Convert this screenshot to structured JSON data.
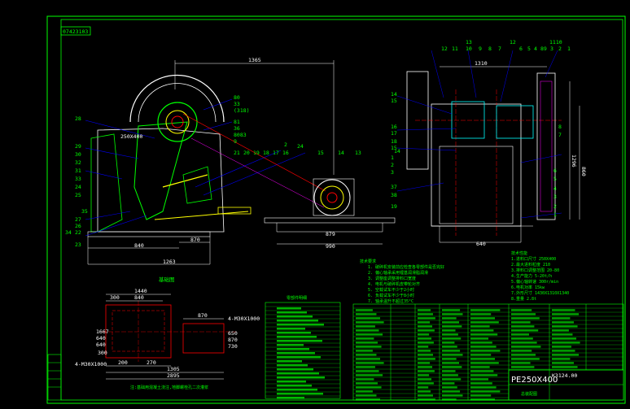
{
  "sheet": {
    "drawing_number": "07423103",
    "model": "PE250X400",
    "scale_code": "K3124.00",
    "total_length_dim": "1365"
  },
  "side_view": {
    "opening_label": "250X400",
    "dims": {
      "width_1": "840",
      "width_2": "870",
      "width_3": "1263"
    },
    "part_numbers_left": [
      "28",
      "29",
      "30",
      "32",
      "31",
      "33",
      "24",
      "25",
      "27",
      "26",
      "22",
      "23",
      "34",
      "35"
    ],
    "part_numbers_right": [
      "80",
      "33",
      "(318)",
      "81",
      "36",
      "8083",
      "9",
      "21",
      "20",
      "19",
      "18",
      "17",
      "16",
      "2",
      "24",
      "15",
      "14",
      "13",
      "14"
    ],
    "motor_dims": {
      "base": "879",
      "width": "990"
    }
  },
  "front_view": {
    "top_numbers": [
      "12",
      "11",
      "13",
      "10",
      "9",
      "8",
      "7",
      "12",
      "6",
      "5",
      "4",
      "89",
      "3",
      "2",
      "1",
      "1110"
    ],
    "dim_top": "1310",
    "dims": {
      "bottom": "640",
      "height_1": "1296",
      "height_2": "860"
    },
    "left_numbers": [
      "14",
      "15",
      "16",
      "17",
      "18",
      "15",
      "1",
      "2",
      "3",
      "37",
      "38",
      "19"
    ],
    "right_numbers": [
      "8",
      "7",
      "6",
      "5",
      "4",
      "3",
      "2",
      "1"
    ]
  },
  "foundation": {
    "title": "基础图",
    "dims": [
      "1440",
      "300",
      "840",
      "270",
      "870",
      "1305",
      "2895",
      "650",
      "870",
      "730",
      "200",
      "1667",
      "640",
      "640",
      "300"
    ],
    "bolt_note_1": "4-M30X1000",
    "bolt_note_2": "4-M30X1000",
    "footnote": "注:基础用混凝土浇注,地脚螺栓孔二次灌浆"
  },
  "notes_title": "技术要求",
  "notes": [
    "1. 破碎机安装前应检查各零部件是否完好",
    "2. 偏心轴承采用锂基润滑脂润滑",
    "3. 调整座调整排料口宽度",
    "4. 电机与破碎机皮带轮对齐",
    "5. 空载试车不少于2小时",
    "6. 负载试车不少于8小时",
    "7. 轴承温升不超过35°C",
    "8. 安装后各紧固件应拧紧"
  ],
  "specs_title": "技术性能",
  "specs": [
    "1.进料口尺寸 250X400",
    "2.最大进料粒度 210",
    "3.排料口调整范围 20-80",
    "4.生产能力 5-20t/h",
    "5.偏心轴转速 300r/min",
    "6.电机功率 15kw",
    "7.外形尺寸 1430X1310X1340",
    "8.重量 2.8t"
  ],
  "parts_list_title": "零部件明细",
  "title_block": {
    "company": "",
    "drawing_title": "总装配图"
  },
  "colors": {
    "background": "#000000",
    "frame": "#00ff00",
    "yellow": "#ffff00",
    "cyan": "#00ffff",
    "red": "#ff0000",
    "blue": "#0000ff",
    "magenta": "#ff00ff",
    "white": "#ffffff",
    "green": "#00ff00"
  }
}
